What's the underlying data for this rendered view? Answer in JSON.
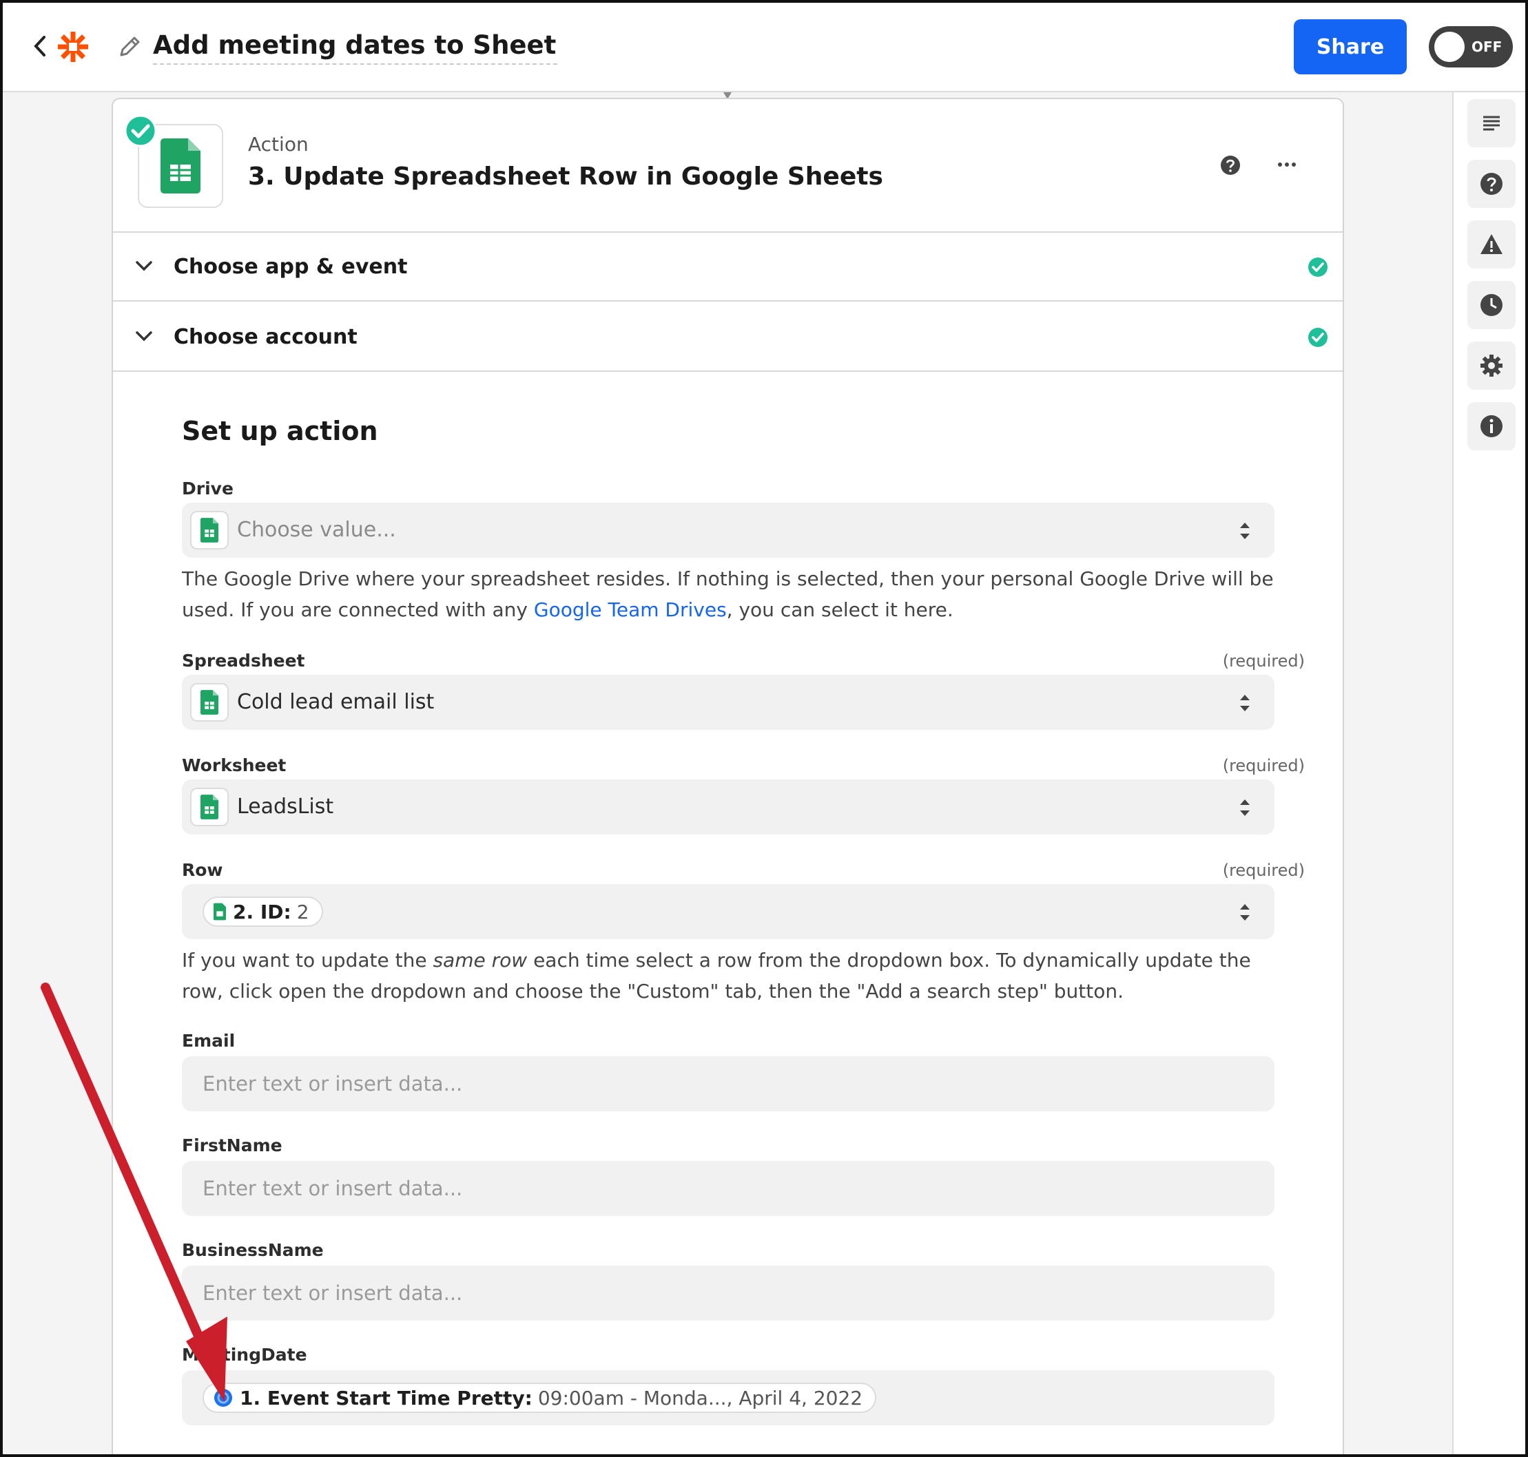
{
  "header": {
    "title": "Add meeting dates to Sheet",
    "share_label": "Share",
    "toggle_label": "OFF"
  },
  "step": {
    "type": "Action",
    "title": "3. Update Spreadsheet Row in Google Sheets"
  },
  "sections": [
    {
      "label": "Choose app & event"
    },
    {
      "label": "Choose account"
    }
  ],
  "setup": {
    "title": "Set up action",
    "required_label": "(required)",
    "drive": {
      "label": "Drive",
      "placeholder": "Choose value...",
      "help_before": "The Google Drive where your spreadsheet resides. If nothing is selected, then your personal Google Drive will be used. If you are connected with any ",
      "help_link": "Google Team Drives",
      "help_after": ", you can select it here."
    },
    "spreadsheet": {
      "label": "Spreadsheet",
      "value": "Cold lead email list"
    },
    "worksheet": {
      "label": "Worksheet",
      "value": "LeadsList"
    },
    "row": {
      "label": "Row",
      "pill_key": "2. ID:",
      "pill_value": "2",
      "help_before": "If you want to update the ",
      "help_em": "same row",
      "help_after": " each time select a row from the dropdown box. To dynamically update the row, click open the dropdown and choose the \"Custom\" tab, then the \"Add a search step\" button."
    },
    "email": {
      "label": "Email",
      "placeholder": "Enter text or insert data..."
    },
    "firstname": {
      "label": "FirstName",
      "placeholder": "Enter text or insert data..."
    },
    "businessname": {
      "label": "BusinessName",
      "placeholder": "Enter text or insert data..."
    },
    "meetingdate": {
      "label": "MeetingDate",
      "pill_key": "1. Event Start Time Pretty:",
      "pill_value": "09:00am - Monda..., April 4, 2022"
    }
  },
  "colors": {
    "accent": "#1565f5",
    "success": "#1fbf9a",
    "sheets_green": "#1fa463",
    "zapier_orange": "#ff4f00",
    "annotation_red": "#cc1f2c"
  }
}
